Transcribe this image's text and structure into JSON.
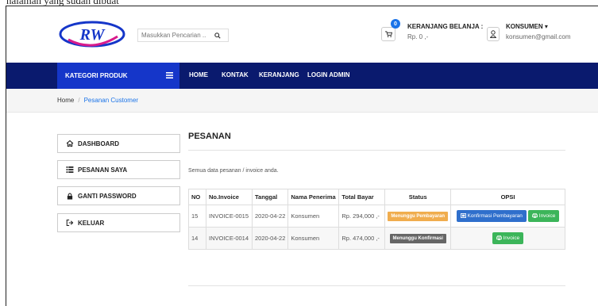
{
  "caption": "halaman yang sudah dibuat",
  "header": {
    "logo_text": "RW",
    "search": {
      "placeholder": "Masukkan Pencarian ..",
      "icon": "search-icon"
    },
    "cart": {
      "count": "0",
      "title": "KERANJANG BELANJA :",
      "total": "Rp. 0 ,-",
      "icon": "cart-icon"
    },
    "user": {
      "name": "KONSUMEN ▾",
      "email": "konsumen@gmail.com",
      "icon": "user-icon"
    }
  },
  "nav": {
    "category_label": "KATEGORI PRODUK",
    "items": [
      "HOME",
      "KONTAK",
      "KERANJANG",
      "LOGIN ADMIN"
    ]
  },
  "breadcrumb": {
    "home": "Home",
    "separator": "/",
    "current": "Pesanan Customer"
  },
  "sidebar": {
    "items": [
      {
        "label": "DASHBOARD",
        "icon": "home-icon"
      },
      {
        "label": "PESANAN SAYA",
        "icon": "list-icon"
      },
      {
        "label": "GANTI PASSWORD",
        "icon": "lock-icon"
      },
      {
        "label": "KELUAR",
        "icon": "logout-icon"
      }
    ]
  },
  "main": {
    "title": "PESANAN",
    "description": "Semua data pesanan / invoice anda.",
    "table": {
      "headers": [
        "NO",
        "No.Invoice",
        "Tanggal",
        "Nama Penerima",
        "Total Bayar",
        "Status",
        "OPSI"
      ],
      "rows": [
        {
          "no": "15",
          "invoice": "INVOICE-0015",
          "date": "2020-04-22",
          "recipient": "Konsumen",
          "total": "Rp. 294,000 ,-",
          "status": "Menunggu Pembayaran",
          "status_color": "#f0ad4e",
          "confirm_label": "Konfirmasi Pembayaran",
          "invoice_label": "Invoice"
        },
        {
          "no": "14",
          "invoice": "INVOICE-0014",
          "date": "2020-04-22",
          "recipient": "Konsumen",
          "total": "Rp. 474,000 ,-",
          "status": "Menunggu Konfirmasi",
          "status_color": "#666666",
          "invoice_label": "Invoice"
        }
      ]
    }
  },
  "colors": {
    "nav_bg": "#0a1a6e",
    "category_bg": "#1536c9",
    "accent": "#1a73e8",
    "button_blue": "#2f6fcc",
    "button_green": "#3cb55a"
  }
}
